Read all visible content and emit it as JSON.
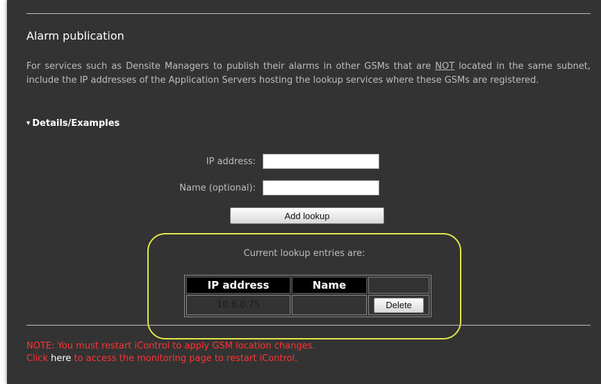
{
  "section": {
    "title": "Alarm publication",
    "description_before": "For services such as Densite Managers to publish their alarms in other GSMs that are ",
    "description_emphasis": "NOT",
    "description_after": " located in the same subnet, include the IP addresses of the Application Servers hosting the lookup services where these GSMs are registered.",
    "details_label": "Details/Examples",
    "details_icon": "caret-down-icon"
  },
  "form": {
    "ip_label": "IP address:",
    "ip_value": "",
    "name_label": "Name (optional):",
    "name_value": "",
    "add_button": "Add lookup"
  },
  "lookup": {
    "caption": "Current lookup entries are:",
    "headers": [
      "IP address",
      "Name",
      ""
    ],
    "rows": [
      {
        "ip": "10.6.0.75",
        "name": "",
        "action": "Delete"
      }
    ],
    "highlight_color": "#e3e64a"
  },
  "note": {
    "line1": "NOTE: You must restart iControl to apply GSM location changes.",
    "line2_prefix": "Click ",
    "line2_link": "here",
    "line2_suffix": " to access the monitoring page to restart iControl.",
    "color": "#ff3333"
  }
}
